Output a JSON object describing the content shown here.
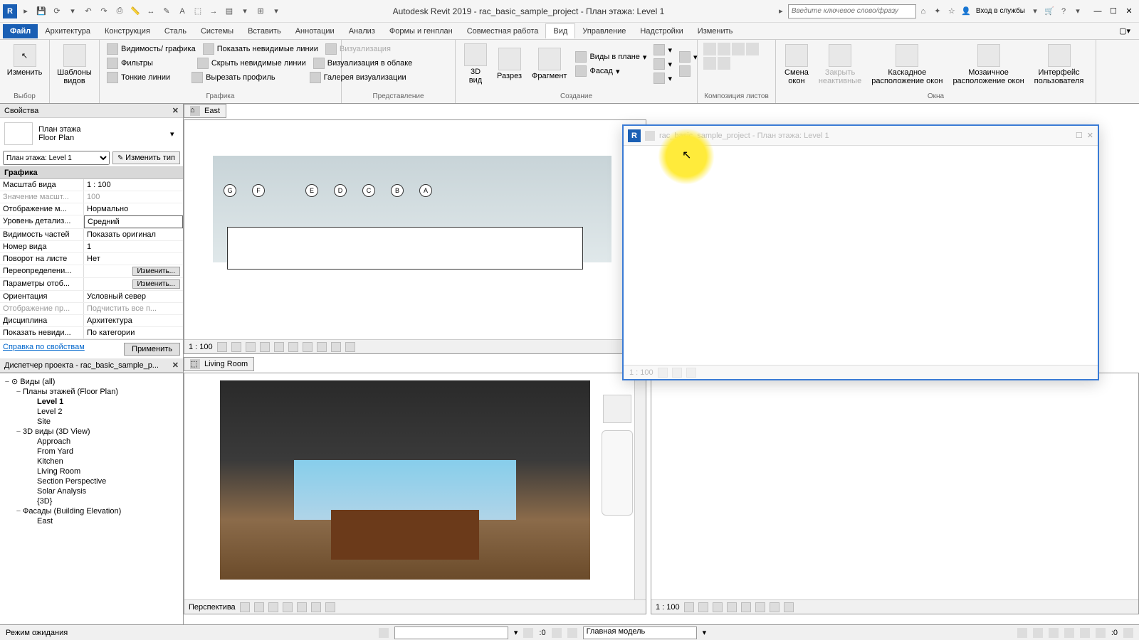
{
  "app": {
    "title": "Autodesk Revit 2019 - rac_basic_sample_project - План этажа: Level 1",
    "search_placeholder": "Введите ключевое слово/фразу",
    "login": "Вход в службы"
  },
  "tabs": {
    "file": "Файл",
    "items": [
      "Архитектура",
      "Конструкция",
      "Сталь",
      "Системы",
      "Вставить",
      "Аннотации",
      "Анализ",
      "Формы и генплан",
      "Совместная работа",
      "Вид",
      "Управление",
      "Надстройки",
      "Изменить"
    ],
    "active": "Вид"
  },
  "ribbon": {
    "select": {
      "modify": "Изменить",
      "templates": "Шаблоны\nвидов",
      "label": "Выбор"
    },
    "graphics": {
      "vis": "Видимость/ графика",
      "show": "Показать невидимые линии",
      "viz": "Визуализация",
      "filters": "Фильтры",
      "hide": "Скрыть невидимые линии",
      "cloud": "Визуализация в облаке",
      "thin": "Тонкие линии",
      "cut": "Вырезать профиль",
      "gallery": "Галерея визуализации",
      "label": "Графика"
    },
    "present": {
      "label": "Представление"
    },
    "create": {
      "3d": "3D\nвид",
      "section": "Разрез",
      "fragment": "Фрагмент",
      "plans": "Виды в плане",
      "facade": "Фасад",
      "label": "Создание"
    },
    "comp": {
      "label": "Композиция листов"
    },
    "windows": {
      "switch": "Смена\nокон",
      "close": "Закрыть\nнеактивные",
      "cascade": "Каскадное\nрасположение окон",
      "tile": "Мозаичное\nрасположение окон",
      "ui": "Интерфейс\nпользователя",
      "label": "Окна"
    }
  },
  "props": {
    "title": "Свойства",
    "type_main": "План этажа",
    "type_sub": "Floor Plan",
    "instance": "План этажа: Level 1",
    "edit_type": "Изменить тип",
    "cat": "Графика",
    "rows": [
      {
        "k": "Масштаб вида",
        "v": "1 : 100"
      },
      {
        "k": "Значение масшт...",
        "v": "100",
        "dis": true
      },
      {
        "k": "Отображение м...",
        "v": "Нормально"
      },
      {
        "k": "Уровень детализ...",
        "v": "Средний",
        "sel": true
      },
      {
        "k": "Видимость частей",
        "v": "Показать оригинал"
      },
      {
        "k": "Номер вида",
        "v": "1"
      },
      {
        "k": "Поворот на листе",
        "v": "Нет"
      },
      {
        "k": "Переопределени...",
        "v": "Изменить...",
        "btn": true
      },
      {
        "k": "Параметры отоб...",
        "v": "Изменить...",
        "btn": true
      },
      {
        "k": "Ориентация",
        "v": "Условный север"
      },
      {
        "k": "Отображение пр...",
        "v": "Подчистить все п...",
        "dis": true
      },
      {
        "k": "Дисциплина",
        "v": "Архитектура"
      },
      {
        "k": "Показать невиди...",
        "v": "По категории"
      }
    ],
    "help": "Справка по свойствам",
    "apply": "Применить"
  },
  "browser": {
    "title": "Диспетчер проекта - rac_basic_sample_p...",
    "views": "Виды (all)",
    "fp": "Планы этажей (Floor Plan)",
    "fp_items": [
      "Level 1",
      "Level 2",
      "Site"
    ],
    "v3d": "3D виды (3D View)",
    "v3d_items": [
      "Approach",
      "From Yard",
      "Kitchen",
      "Living Room",
      "Section Perspective",
      "Solar Analysis",
      "{3D}"
    ],
    "elev": "Фасады (Building Elevation)",
    "elev_items": [
      "East"
    ]
  },
  "views": {
    "east": "East",
    "living": "Living Room",
    "persp": "Перспектива",
    "scale100": "1 : 100",
    "grids": [
      "G",
      "F",
      "E",
      "D",
      "C",
      "B",
      "A"
    ]
  },
  "float": {
    "title": "rac_basic_sample_project - План этажа: Level 1",
    "scale": "1 : 100"
  },
  "status": {
    "mode": "Режим ожидания",
    "zero": ":0",
    "model": "Главная модель"
  }
}
